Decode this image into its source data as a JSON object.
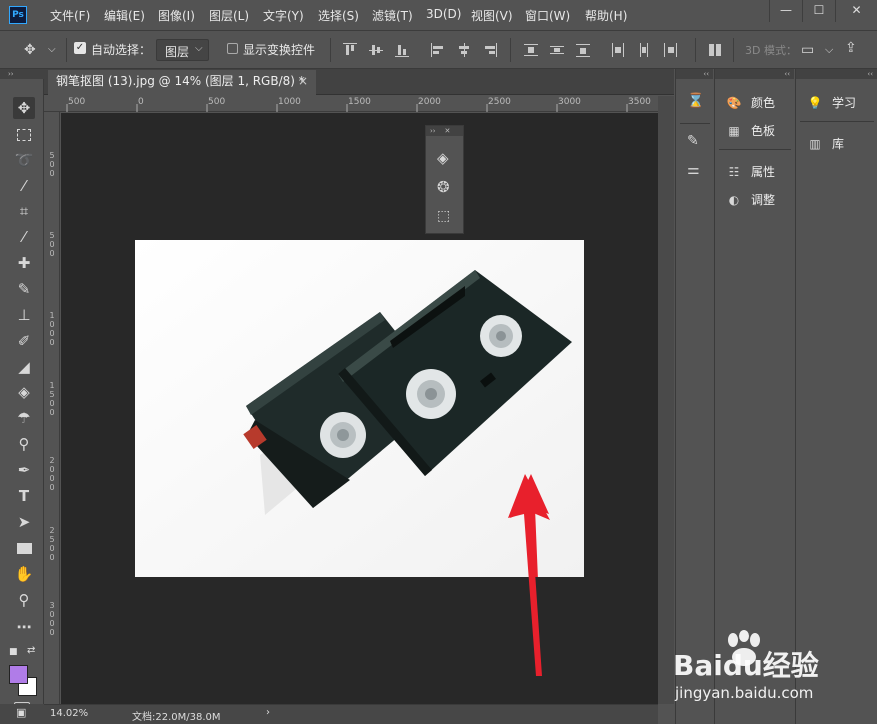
{
  "app": {
    "logo_text": "Ps"
  },
  "menu": [
    {
      "label": "文件(F)"
    },
    {
      "label": "编辑(E)"
    },
    {
      "label": "图像(I)"
    },
    {
      "label": "图层(L)"
    },
    {
      "label": "文字(Y)"
    },
    {
      "label": "选择(S)"
    },
    {
      "label": "滤镜(T)"
    },
    {
      "label": "3D(D)"
    },
    {
      "label": "视图(V)"
    },
    {
      "label": "窗口(W)"
    },
    {
      "label": "帮助(H)"
    }
  ],
  "window_controls": {
    "minimize": "—",
    "maximize": "☐",
    "close": "✕"
  },
  "options": {
    "auto_select_label": "自动选择：",
    "auto_select_checked": true,
    "layer_select": "图层",
    "show_transform_label": "显示变换控件",
    "mode_3d_label": "3D 模式："
  },
  "document": {
    "tab_title": "钢笔抠图 (13).jpg @ 14% (图层 1, RGB/8) *",
    "close_glyph": "×"
  },
  "ruler": {
    "h_labels": [
      "500",
      "0",
      "500",
      "1000",
      "1500",
      "2000",
      "2500",
      "3000",
      "3500"
    ],
    "v_labels": [
      "5",
      "0",
      "0",
      "5",
      "0",
      "0",
      "1",
      "0",
      "0",
      "0",
      "1",
      "5",
      "0",
      "0",
      "2",
      "0",
      "0",
      "0",
      "2",
      "5",
      "0",
      "0",
      "3",
      "0",
      "0",
      "0"
    ]
  },
  "status": {
    "zoom": "14.02%",
    "doc_info": "文档:22.0M/38.0M",
    "arrow": "›"
  },
  "panels": {
    "group2": [
      {
        "label": "颜色",
        "icon": "palette-icon"
      },
      {
        "label": "色板",
        "icon": "swatches-icon"
      },
      {
        "label": "属性",
        "icon": "properties-icon"
      },
      {
        "label": "调整",
        "icon": "adjustments-icon"
      }
    ],
    "group3": [
      {
        "label": "学习",
        "icon": "lightbulb-icon"
      },
      {
        "label": "库",
        "icon": "library-icon"
      }
    ]
  },
  "tools": [
    "move-tool",
    "marquee-tool",
    "lasso-tool",
    "magic-wand-tool",
    "crop-tool",
    "eyedropper-tool",
    "healing-brush-tool",
    "brush-tool",
    "clone-stamp-tool",
    "history-brush-tool",
    "eraser-tool",
    "paint-bucket-tool",
    "blur-tool",
    "dodge-tool",
    "pen-tool",
    "type-tool",
    "path-selection-tool",
    "rectangle-tool",
    "hand-tool",
    "zoom-tool",
    "more-tools"
  ],
  "colors": {
    "foreground": "#b07ce8",
    "background": "#ffffff",
    "annotation_arrow": "#e8202c"
  },
  "watermark": {
    "brand": "Baidu经验",
    "url": "jingyan.baidu.com"
  }
}
